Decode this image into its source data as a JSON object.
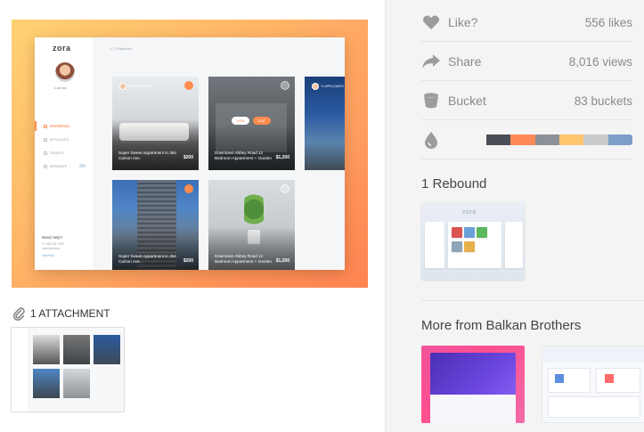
{
  "shot": {
    "mock": {
      "logo": "zora",
      "username": "c.atrous",
      "search_placeholder": "7 Properties",
      "nav": [
        {
          "label": "PROPERTIES",
          "active": true
        },
        {
          "label": "APPLICANTS",
          "active": false
        },
        {
          "label": "TENANTS",
          "active": false
        },
        {
          "label": "MESSAGES",
          "active": false
        }
      ],
      "help_title": "Need Help?",
      "help_phone": "+1 468 545 7500",
      "help_email": "hello@zora.io",
      "help_link": "Visit FAQ",
      "cards": [
        {
          "applicants": "+1 APPLICANTS",
          "title": "Super Sweet Appartment in 354 Carson Ave.",
          "price": "$200"
        },
        {
          "title": "Downtown Abbey Road 12 Bedroom Appartment + Garden",
          "price": "$1,200",
          "view": "VIEW",
          "edit": "EDIT"
        },
        {
          "applicants": "+1 APPLICANTS"
        },
        {
          "title": "Super Sweet Appartment in 354 Carson Ave.",
          "price": "$200"
        },
        {
          "title": "Downtown Abbey Road 12 Bedroom Appartment + Garden",
          "price": "$1,200"
        }
      ]
    }
  },
  "attachments": {
    "label": "1 ATTACHMENT"
  },
  "stats": {
    "like_label": "Like?",
    "like_value": "556 likes",
    "share_label": "Share",
    "share_value": "8,016 views",
    "bucket_label": "Bucket",
    "bucket_value": "83 buckets",
    "palette": [
      "#f4f4f4",
      "#4a4f57",
      "#ff8a57",
      "#8c9199",
      "#ffc46e",
      "#c9cbcd",
      "#7d9ec6"
    ]
  },
  "rebounds": {
    "title": "1 Rebound",
    "thumb_logo": "zora"
  },
  "more": {
    "title": "More from Balkan Brothers"
  }
}
